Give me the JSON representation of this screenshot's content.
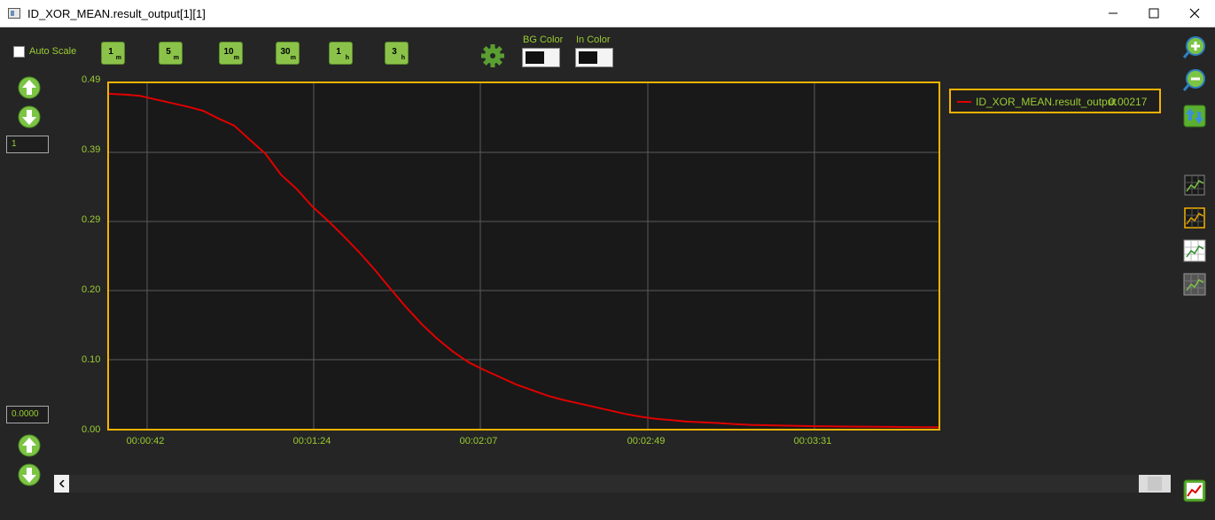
{
  "window": {
    "title": "ID_XOR_MEAN.result_output[1][1]"
  },
  "toolbar": {
    "auto_scale_label": "Auto Scale",
    "auto_scale_checked": false,
    "time_buttons": [
      {
        "number": "1",
        "unit": "m"
      },
      {
        "number": "5",
        "unit": "m"
      },
      {
        "number": "10",
        "unit": "m"
      },
      {
        "number": "30",
        "unit": "m"
      },
      {
        "number": "1",
        "unit": "h"
      },
      {
        "number": "3",
        "unit": "h"
      }
    ],
    "bg_color_label": "BG Color",
    "in_color_label": "In Color"
  },
  "scale": {
    "max_value": "1",
    "min_value": "0.0000"
  },
  "legend": {
    "name": "ID_XOR_MEAN.result_output",
    "value": "0.00217"
  },
  "colors": {
    "accent": "#9acd32",
    "plot_border": "#f5b300",
    "series": "#e00000",
    "plot_bg": "#191919",
    "window_bg": "#252525"
  },
  "chart_data": {
    "type": "line",
    "title": "",
    "xlabel": "",
    "ylabel": "",
    "ylim": [
      0.0,
      0.49
    ],
    "x_ticks": [
      "00:00:42",
      "00:01:24",
      "00:02:07",
      "00:02:49",
      "00:03:31"
    ],
    "y_ticks": [
      "0.49",
      "0.39",
      "0.29",
      "0.20",
      "0.10",
      "0.00"
    ],
    "grid": true,
    "legend_position": "right",
    "series": [
      {
        "name": "ID_XOR_MEAN.result_output",
        "x_seconds": [
          0,
          4,
          8,
          12,
          16,
          20,
          24,
          28,
          32,
          36,
          40,
          44,
          48,
          52,
          56,
          60,
          64,
          68,
          72,
          76,
          80,
          84,
          88,
          92,
          96,
          100,
          104,
          108,
          112,
          116,
          120,
          124,
          128,
          132,
          136,
          140,
          144,
          148,
          152,
          156,
          160,
          164,
          168,
          172,
          176,
          180,
          184,
          188,
          192,
          196,
          200,
          204,
          208,
          212
        ],
        "values": [
          0.475,
          0.474,
          0.472,
          0.467,
          0.462,
          0.457,
          0.451,
          0.44,
          0.43,
          0.41,
          0.39,
          0.36,
          0.34,
          0.315,
          0.295,
          0.273,
          0.25,
          0.225,
          0.198,
          0.172,
          0.148,
          0.127,
          0.109,
          0.094,
          0.083,
          0.073,
          0.063,
          0.055,
          0.047,
          0.041,
          0.036,
          0.031,
          0.026,
          0.021,
          0.017,
          0.014,
          0.012,
          0.01,
          0.009,
          0.008,
          0.0065,
          0.0055,
          0.005,
          0.0045,
          0.004,
          0.0037,
          0.0034,
          0.0032,
          0.003,
          0.0028,
          0.0026,
          0.0024,
          0.0023,
          0.0022
        ]
      }
    ]
  }
}
